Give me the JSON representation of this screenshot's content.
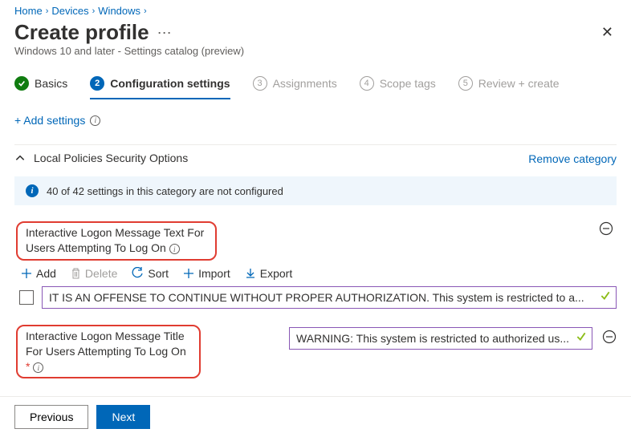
{
  "breadcrumb": {
    "items": [
      "Home",
      "Devices",
      "Windows"
    ]
  },
  "page": {
    "title": "Create profile",
    "subtitle": "Windows 10 and later - Settings catalog (preview)"
  },
  "wizard": {
    "steps": [
      {
        "label": "Basics"
      },
      {
        "num": "2",
        "label": "Configuration settings"
      },
      {
        "num": "3",
        "label": "Assignments"
      },
      {
        "num": "4",
        "label": "Scope tags"
      },
      {
        "num": "5",
        "label": "Review + create"
      }
    ]
  },
  "actions": {
    "add_settings": "+ Add settings"
  },
  "category": {
    "name": "Local Policies Security Options",
    "remove_label": "Remove category",
    "info": "40 of 42 settings in this category are not configured"
  },
  "toolbar": {
    "add": "Add",
    "delete": "Delete",
    "sort": "Sort",
    "import": "Import",
    "export": "Export"
  },
  "settings": {
    "s1": {
      "label": "Interactive Logon Message Text For Users Attempting To Log On",
      "value": "IT IS AN OFFENSE TO CONTINUE WITHOUT PROPER AUTHORIZATION. This system is restricted to a..."
    },
    "s2": {
      "label": "Interactive Logon Message Title For Users Attempting To Log On",
      "required": "*",
      "value": "WARNING: This system is restricted to authorized us..."
    }
  },
  "footer": {
    "prev": "Previous",
    "next": "Next"
  }
}
